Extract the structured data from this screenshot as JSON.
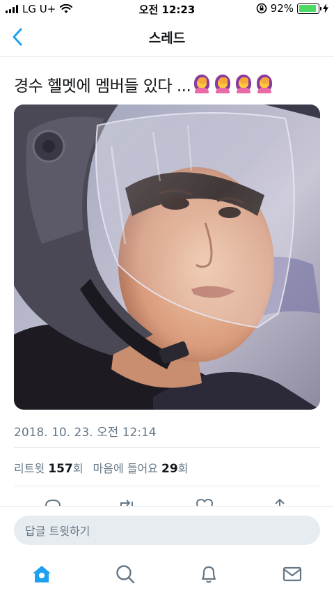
{
  "status_bar": {
    "carrier": "LG U+",
    "time": "오전 12:23",
    "battery_percent": "92%",
    "battery_level": 0.92,
    "icons": [
      "signal-icon",
      "wifi-icon",
      "rotation-lock-icon",
      "battery-icon",
      "charging-icon"
    ]
  },
  "nav": {
    "title": "스레드",
    "back_icon": "back-chevron-icon"
  },
  "tweet": {
    "text": "경수 헬멧에 멤버들 있다 ...",
    "emoji": [
      "person-facepalming",
      "person-facepalming",
      "person-facepalming",
      "person-facepalming"
    ],
    "photo": "person-in-motorcycle-helmet-photo",
    "date": "2018. 10. 23. 오전 12:14",
    "retweets": {
      "label": "리트윗",
      "count": "157",
      "suffix": "회"
    },
    "likes": {
      "label": "마음에 들어요",
      "count": "29",
      "suffix": "회"
    },
    "actions": [
      "reply-icon",
      "retweet-icon",
      "like-icon",
      "share-icon"
    ]
  },
  "reply": {
    "placeholder": "답글 트윗하기"
  },
  "tab_bar": {
    "tabs": [
      "home-icon",
      "search-icon",
      "notifications-icon",
      "messages-icon"
    ],
    "active": "home-icon"
  },
  "colors": {
    "accent": "#1da1f2",
    "secondary_text": "#657786",
    "divider": "#e1e8ed",
    "input_bg": "#e6ecf0",
    "battery": "#4cd964"
  }
}
